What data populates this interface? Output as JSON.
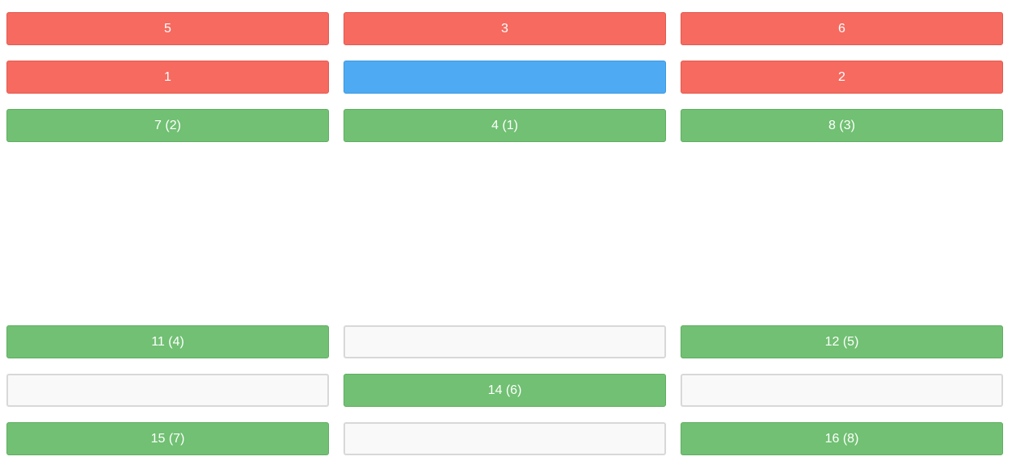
{
  "colors": {
    "red": "#f66a60",
    "blue": "#4eabf3",
    "green": "#71c073",
    "empty": "#f9f9f9",
    "empty_border": "#d8d8d8",
    "text": "#ffffff"
  },
  "tiles": {
    "r1c1": "5",
    "r1c2": "3",
    "r1c3": "6",
    "r2c1": "1",
    "r2c2": "",
    "r2c3": "2",
    "r3c1": "7 (2)",
    "r3c2": "4 (1)",
    "r3c3": "8 (3)",
    "r4c1": "11 (4)",
    "r4c2": "",
    "r4c3": "12 (5)",
    "r5c1": "",
    "r5c2": "14 (6)",
    "r5c3": "",
    "r6c1": "15 (7)",
    "r6c2": "",
    "r6c3": "16 (8)"
  }
}
